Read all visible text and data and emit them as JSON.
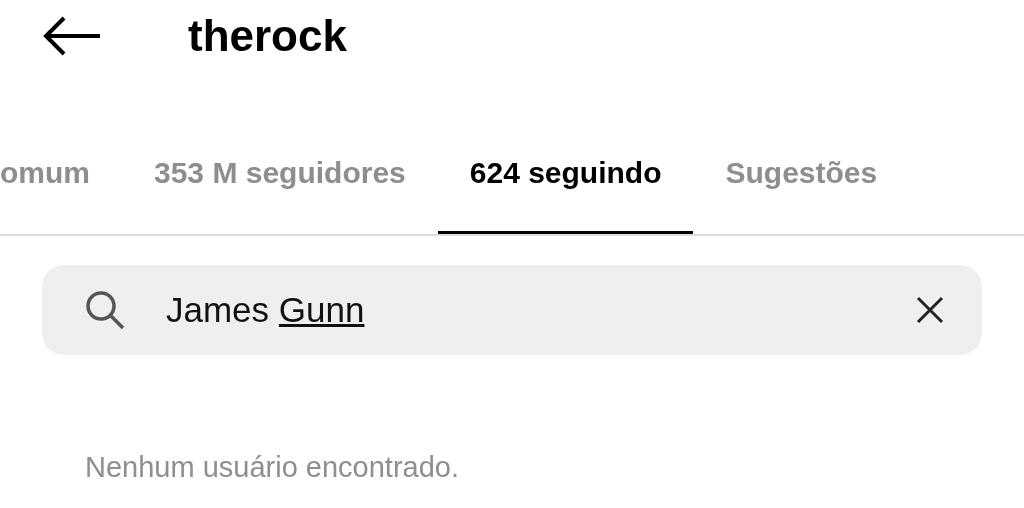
{
  "header": {
    "title": "therock"
  },
  "tabs": [
    {
      "label": "omum",
      "selected": false
    },
    {
      "label": "353 M seguidores",
      "selected": false
    },
    {
      "label": "624 seguindo",
      "selected": true
    },
    {
      "label": "Sugestões",
      "selected": false
    }
  ],
  "search": {
    "value_parts": [
      {
        "text": "James ",
        "underlined": false
      },
      {
        "text": "Gunn",
        "underlined": true
      }
    ]
  },
  "empty_message": "Nenhum usuário encontrado."
}
